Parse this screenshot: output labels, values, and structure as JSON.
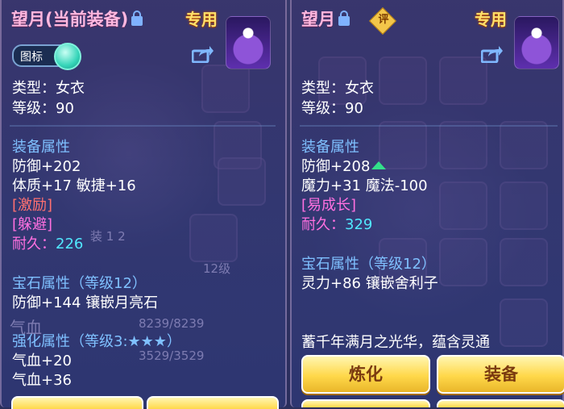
{
  "left": {
    "title_name": "望月",
    "title_suffix": "(当前装备)",
    "special": "专用",
    "toggle_label": "图标",
    "type": "类型：女衣",
    "level": "等级：90",
    "section_equip": "装备属性",
    "defense": "防御+202",
    "stats": "体质+17 敏捷+16",
    "tag1": "[激励]",
    "tag2": "[躲避]",
    "durability_label": "耐久：",
    "durability_value": "226",
    "gem_section": "宝石属性（等级12）",
    "gem_stats": "防御+144 镶嵌月亮石",
    "enhance_section": "强化属性（等级3:★★★）",
    "enhance_1": "气血+20",
    "enhance_2": "气血+36"
  },
  "right": {
    "title_name": "望月",
    "seal": "评",
    "special": "专用",
    "type": "类型：女衣",
    "level": "等级：90",
    "section_equip": "装备属性",
    "defense": "防御+208",
    "stats": "魔力+31 魔法-100",
    "tag1": "[易成长]",
    "durability_label": "耐久：",
    "durability_value": "329",
    "gem_section": "宝石属性（等级12）",
    "gem_stats": "灵力+86 镶嵌舍利子",
    "description": "蓄千年满月之光华，蕴含灵通",
    "btn_refine": "炼化",
    "btn_equip": "装备"
  },
  "background": {
    "hp_bar": "8239/8239",
    "mp_bar": "3529/3529",
    "level_badge": "12级",
    "qixue": "气血"
  },
  "colors": {
    "title_pink": "#ffb8e0",
    "special_gold": "#ffe06a",
    "section_blue": "#7fc0ff",
    "durability_cyan": "#51e8ff",
    "tag_red": "#ff7070",
    "tag_magenta": "#ff70e0",
    "button_gold": "#ffd84a",
    "button_text": "#7a3a10"
  },
  "icons": [
    "lock-icon",
    "share-icon",
    "avatar-icon",
    "rating-seal-icon",
    "arrow-up-icon",
    "toggle-knob-icon"
  ]
}
